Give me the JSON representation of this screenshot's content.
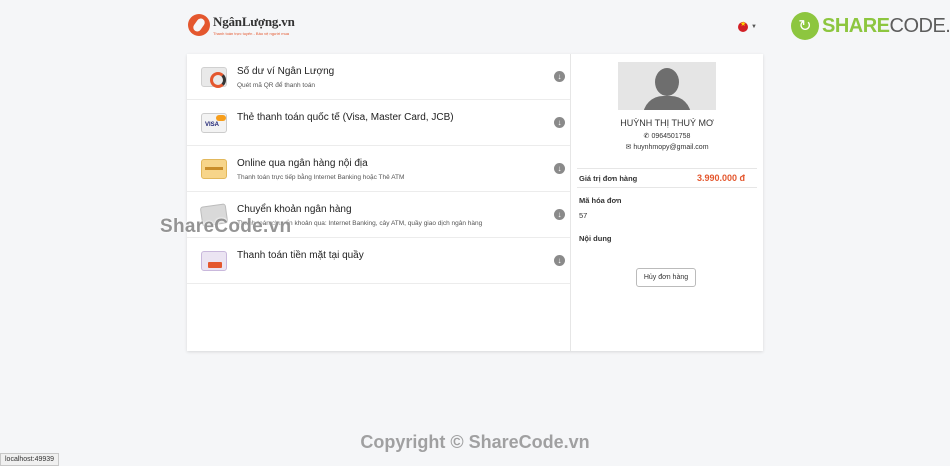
{
  "header": {
    "logo_name": "NgânLượng.vn",
    "logo_tagline": "Thanh toán trực tuyến - Bảo vệ người mua",
    "lang_flag_icon": "vietnam-flag-icon",
    "brand_logo_symbol": "↻",
    "brand_logo_part1": "SHARE",
    "brand_logo_part2": "CODE.vn"
  },
  "methods": [
    {
      "title": "Số dư ví Ngân Lượng",
      "subtitle": "Quét mã QR để thanh toán",
      "icon": "wallet-icon"
    },
    {
      "title": "Thẻ thanh toán quốc tế (Visa, Master Card, JCB)",
      "subtitle": "",
      "icon": "visa-card-icon"
    },
    {
      "title": "Online qua ngân hàng nội địa",
      "subtitle": "Thanh toán trực tiếp bằng Internet Banking hoặc Thẻ ATM",
      "icon": "atm-card-icon"
    },
    {
      "title": "Chuyển khoản ngân hàng",
      "subtitle": "Thanh toán chuyển khoản qua: Internet Banking, cây ATM, quầy giao dịch ngân hàng",
      "icon": "bank-transfer-icon"
    },
    {
      "title": "Thanh toán tiền mặt tại quầy",
      "subtitle": "",
      "icon": "cash-counter-icon"
    }
  ],
  "customer": {
    "name": "HUỲNH THỊ THUÝ MƠ",
    "phone": "0964501758",
    "email": "huynhmopy@gmail.com"
  },
  "order": {
    "total_label": "Giá trị đơn hàng",
    "total_value": "3.990.000 đ",
    "code_label": "Mã hóa đơn",
    "code_value": "57",
    "content_label": "Nội dung",
    "content_value": "",
    "cancel_label": "Hủy đơn hàng"
  },
  "overlay": {
    "watermark": "ShareCode.vn",
    "copyright": "Copyright © ShareCode.vn"
  },
  "statusbar": {
    "url": "localhost:49939"
  },
  "colors": {
    "accent": "#e4572e",
    "brand_green": "#8dc63f"
  }
}
